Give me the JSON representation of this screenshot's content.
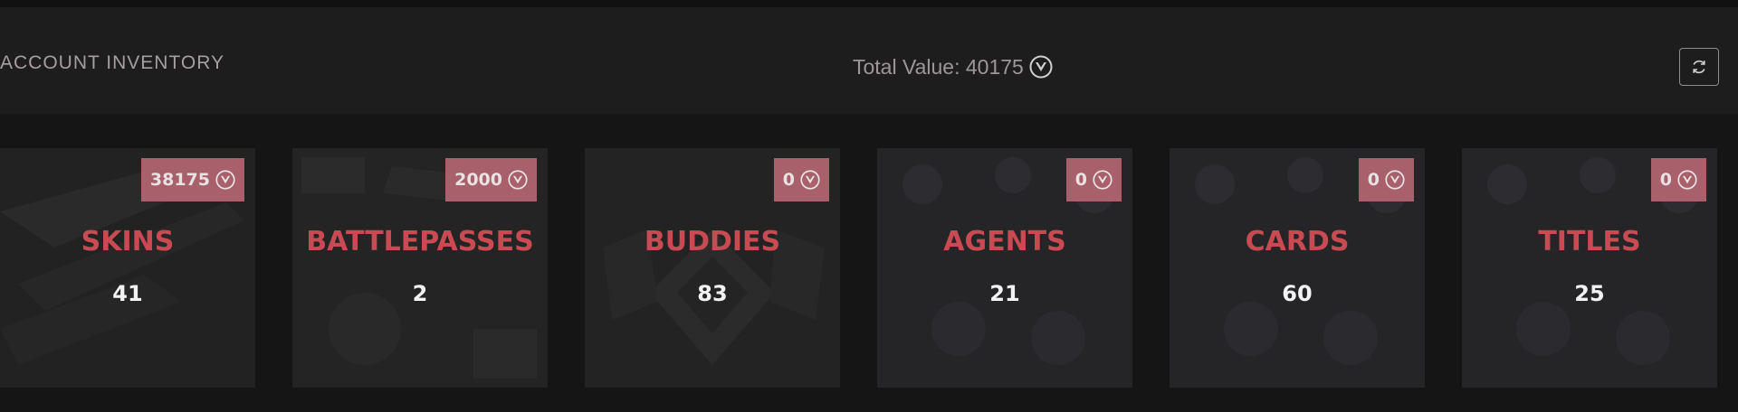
{
  "header": {
    "title": "ACCOUNT INVENTORY",
    "total_label": "Total Value: 40175",
    "currency_icon": "valorant-points-icon",
    "refresh_icon": "refresh-icon"
  },
  "colors": {
    "background": "#151515",
    "header_bg": "#1d1d1d",
    "badge_bg": "#a8606a",
    "category_name": "#c94a52",
    "count_text": "#f2f2f2"
  },
  "categories": [
    {
      "name": "SKINS",
      "value": "38175",
      "count": "41"
    },
    {
      "name": "BATTLEPASSES",
      "value": "2000",
      "count": "2"
    },
    {
      "name": "BUDDIES",
      "value": "0",
      "count": "83"
    },
    {
      "name": "AGENTS",
      "value": "0",
      "count": "21"
    },
    {
      "name": "CARDS",
      "value": "0",
      "count": "60"
    },
    {
      "name": "TITLES",
      "value": "0",
      "count": "25"
    }
  ]
}
